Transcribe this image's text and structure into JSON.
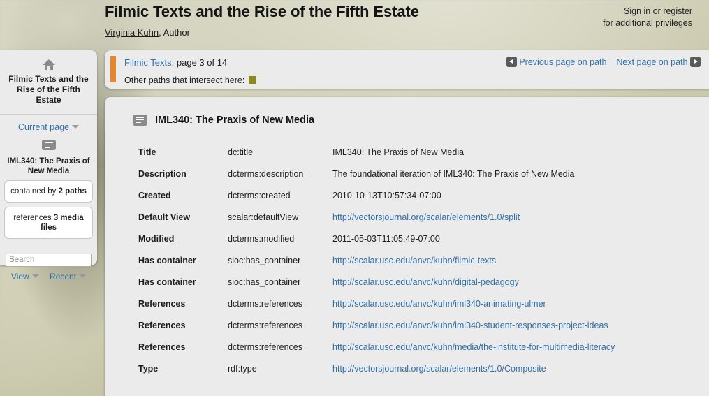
{
  "header": {
    "title": "Filmic Texts and the Rise of the Fifth Estate",
    "author_name": "Virginia Kuhn",
    "author_role": ", Author",
    "sign_in": "Sign in",
    "or": " or ",
    "register": "register",
    "privileges_note": "for additional privileges"
  },
  "sidebar": {
    "home_icon": "home-icon",
    "book_title": "Filmic Texts and the Rise of the Fifth Estate",
    "current_page_label": "Current page",
    "page_icon": "page-icon",
    "current_page_name": "IML340: The Praxis of New Media",
    "contained_by_prefix": "contained by ",
    "contained_by_count": "2 paths",
    "references_prefix": "references ",
    "references_count": "3 media files",
    "search_placeholder": "Search",
    "search_value": "",
    "view_label": "View",
    "recent_label": "Recent"
  },
  "breadcrumb": {
    "path_name": "Filmic Texts",
    "page_position": ", page 3 of 14",
    "intersect_label": "Other paths that intersect here:",
    "intersect_swatch_color": "#8a8a23",
    "accent_bar_color": "#e4872f",
    "prev_label": "Previous page on path",
    "next_label": "Next page on path"
  },
  "content": {
    "page_icon": "page-icon",
    "title": "IML340: The Praxis of New Media",
    "rows": [
      {
        "label": "Title",
        "predicate": "dc:title",
        "value": "IML340: The Praxis of New Media",
        "is_link": false
      },
      {
        "label": "Description",
        "predicate": "dcterms:description",
        "value": "The foundational iteration of IML340: The Praxis of New Media",
        "is_link": false
      },
      {
        "label": "Created",
        "predicate": "dcterms:created",
        "value": "2010-10-13T10:57:34-07:00",
        "is_link": false
      },
      {
        "label": "Default View",
        "predicate": "scalar:defaultView",
        "value": "http://vectorsjournal.org/scalar/elements/1.0/split",
        "is_link": true
      },
      {
        "label": "Modified",
        "predicate": "dcterms:modified",
        "value": "2011-05-03T11:05:49-07:00",
        "is_link": false
      },
      {
        "label": "Has container",
        "predicate": "sioc:has_container",
        "value": "http://scalar.usc.edu/anvc/kuhn/filmic-texts",
        "is_link": true
      },
      {
        "label": "Has container",
        "predicate": "sioc:has_container",
        "value": "http://scalar.usc.edu/anvc/kuhn/digital-pedagogy",
        "is_link": true
      },
      {
        "label": "References",
        "predicate": "dcterms:references",
        "value": "http://scalar.usc.edu/anvc/kuhn/iml340-animating-ulmer",
        "is_link": true
      },
      {
        "label": "References",
        "predicate": "dcterms:references",
        "value": "http://scalar.usc.edu/anvc/kuhn/iml340-student-responses-project-ideas",
        "is_link": true
      },
      {
        "label": "References",
        "predicate": "dcterms:references",
        "value": "http://scalar.usc.edu/anvc/kuhn/media/the-institute-for-multimedia-literacy",
        "is_link": true
      },
      {
        "label": "Type",
        "predicate": "rdf:type",
        "value": "http://vectorsjournal.org/scalar/elements/1.0/Composite",
        "is_link": true
      }
    ]
  },
  "colors": {
    "link": "#2f6fa8",
    "panel": "#ebebeb",
    "accent_orange": "#e4872f"
  }
}
